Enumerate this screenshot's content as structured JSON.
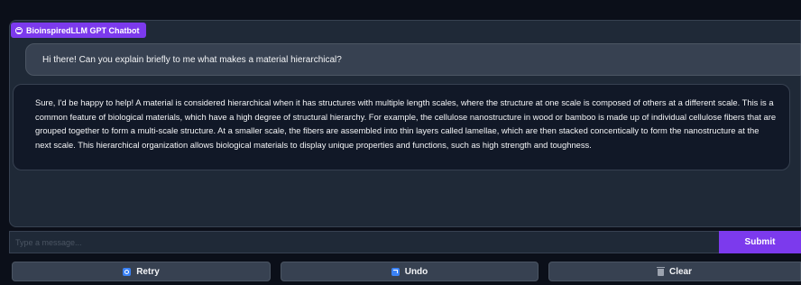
{
  "chatbot": {
    "label": "BioinspiredLLM GPT Chatbot",
    "label_icon": "chatbot-icon"
  },
  "messages": [
    {
      "role": "user",
      "text": "Hi there! Can you explain briefly to me what makes a material hierarchical?"
    },
    {
      "role": "assistant",
      "text": "Sure, I'd be happy to help! A material is considered hierarchical when it has structures with multiple length scales, where the structure at one scale is composed of others at a different scale. This is a common feature of biological materials, which have a high degree of structural hierarchy. For example, the cellulose nanostructure in wood or bamboo is made up of individual cellulose fibers that are grouped together to form a multi-scale structure. At a smaller scale, the fibers are assembled into thin layers called lamellae, which are then stacked concentically to form the nanostructure at the next scale. This hierarchical organization allows biological materials to display unique properties and functions, such as high strength and toughness."
    }
  ],
  "input": {
    "placeholder": "Type a message...",
    "value": ""
  },
  "buttons": {
    "submit": "Submit",
    "retry": "Retry",
    "undo": "Undo",
    "clear": "Clear"
  },
  "icons": {
    "retry": "retry-icon",
    "undo": "undo-icon",
    "clear": "trash-icon"
  },
  "colors": {
    "accent": "#7c3aed",
    "background": "#0b0f19",
    "panel": "#1f2937",
    "icon_blue": "#3b82f6"
  }
}
